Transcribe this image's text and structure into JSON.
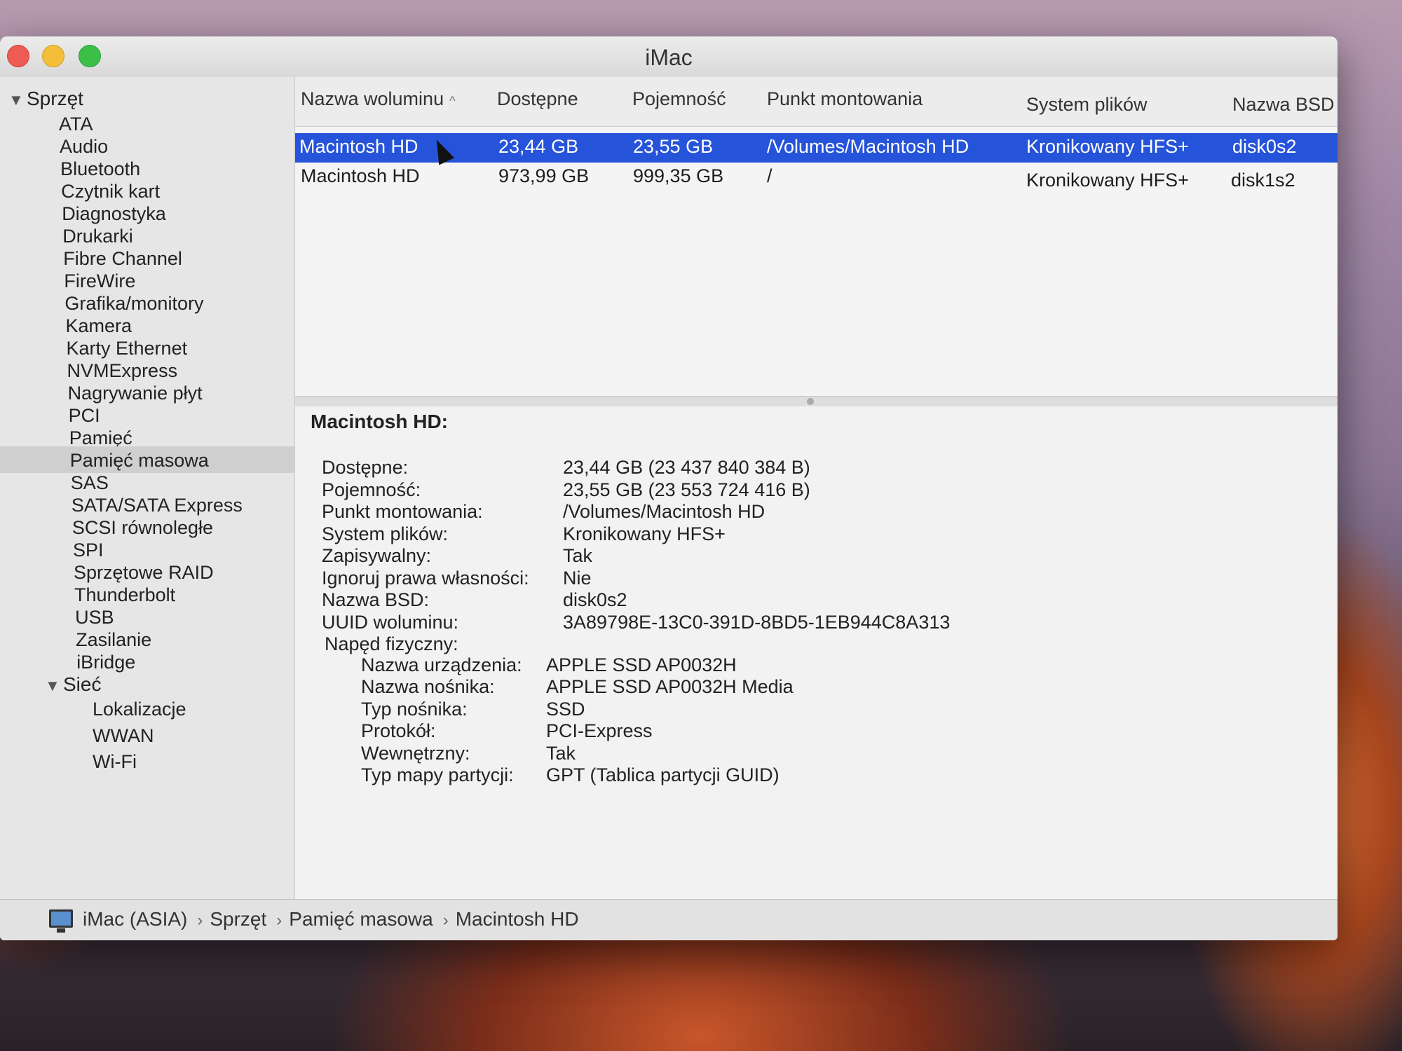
{
  "window": {
    "title": "iMac"
  },
  "sidebar": {
    "groups": [
      {
        "label": "Sprzęt",
        "items": [
          "ATA",
          "Audio",
          "Bluetooth",
          "Czytnik kart",
          "Diagnostyka",
          "Drukarki",
          "Fibre Channel",
          "FireWire",
          "Grafika/monitory",
          "Kamera",
          "Karty Ethernet",
          "NVMExpress",
          "Nagrywanie płyt",
          "PCI",
          "Pamięć",
          "Pamięć masowa",
          "SAS",
          "SATA/SATA Express",
          "SCSI równoległe",
          "SPI",
          "Sprzętowe RAID",
          "Thunderbolt",
          "USB",
          "Zasilanie",
          "iBridge"
        ]
      },
      {
        "label": "Sieć",
        "items": [
          "Lokalizacje",
          "WWAN",
          "Wi-Fi"
        ]
      }
    ],
    "selected": "Pamięć masowa"
  },
  "table": {
    "columns": [
      "Nazwa woluminu",
      "Dostępne",
      "Pojemność",
      "Punkt montowania",
      "System plików",
      "Nazwa BSD"
    ],
    "rows": [
      [
        "Macintosh HD",
        "23,44 GB",
        "23,55 GB",
        "/Volumes/Macintosh HD",
        "Kronikowany HFS+",
        "disk0s2"
      ],
      [
        "Macintosh HD",
        "973,99 GB",
        "999,35 GB",
        "/",
        "Kronikowany HFS+",
        "disk1s2"
      ]
    ],
    "selected_row": 0
  },
  "detail": {
    "title": "Macintosh HD:",
    "fields": [
      {
        "label": "Dostępne:",
        "value": "23,44 GB (23 437 840 384 B)"
      },
      {
        "label": "Pojemność:",
        "value": "23,55 GB (23 553 724 416 B)"
      },
      {
        "label": "Punkt montowania:",
        "value": "/Volumes/Macintosh HD"
      },
      {
        "label": "System plików:",
        "value": "Kronikowany HFS+"
      },
      {
        "label": "Zapisywalny:",
        "value": "Tak"
      },
      {
        "label": "Ignoruj prawa własności:",
        "value": "Nie"
      },
      {
        "label": "Nazwa BSD:",
        "value": "disk0s2"
      },
      {
        "label": "UUID woluminu:",
        "value": "3A89798E-13C0-391D-8BD5-1EB944C8A313"
      }
    ],
    "physical_drive_label": "Napęd fizyczny:",
    "physical": [
      {
        "label": "Nazwa urządzenia:",
        "value": "APPLE SSD AP0032H"
      },
      {
        "label": "Nazwa nośnika:",
        "value": "APPLE SSD AP0032H Media"
      },
      {
        "label": "Typ nośnika:",
        "value": "SSD"
      },
      {
        "label": "Protokół:",
        "value": "PCI-Express"
      },
      {
        "label": "Wewnętrzny:",
        "value": "Tak"
      },
      {
        "label": "Typ mapy partycji:",
        "value": "GPT (Tablica partycji GUID)"
      }
    ]
  },
  "breadcrumb": [
    "iMac (ASIA)",
    "Sprzęt",
    "Pamięć masowa",
    "Macintosh HD"
  ],
  "colors": {
    "selection": "#2553d9",
    "close": "#ee5b52",
    "minimize": "#f4bd3a",
    "zoom": "#3cbf48"
  },
  "icons": {
    "computer": "imac-icon",
    "disclosure": "disclosure-triangle-icon",
    "sort": "sort-ascending-icon"
  }
}
